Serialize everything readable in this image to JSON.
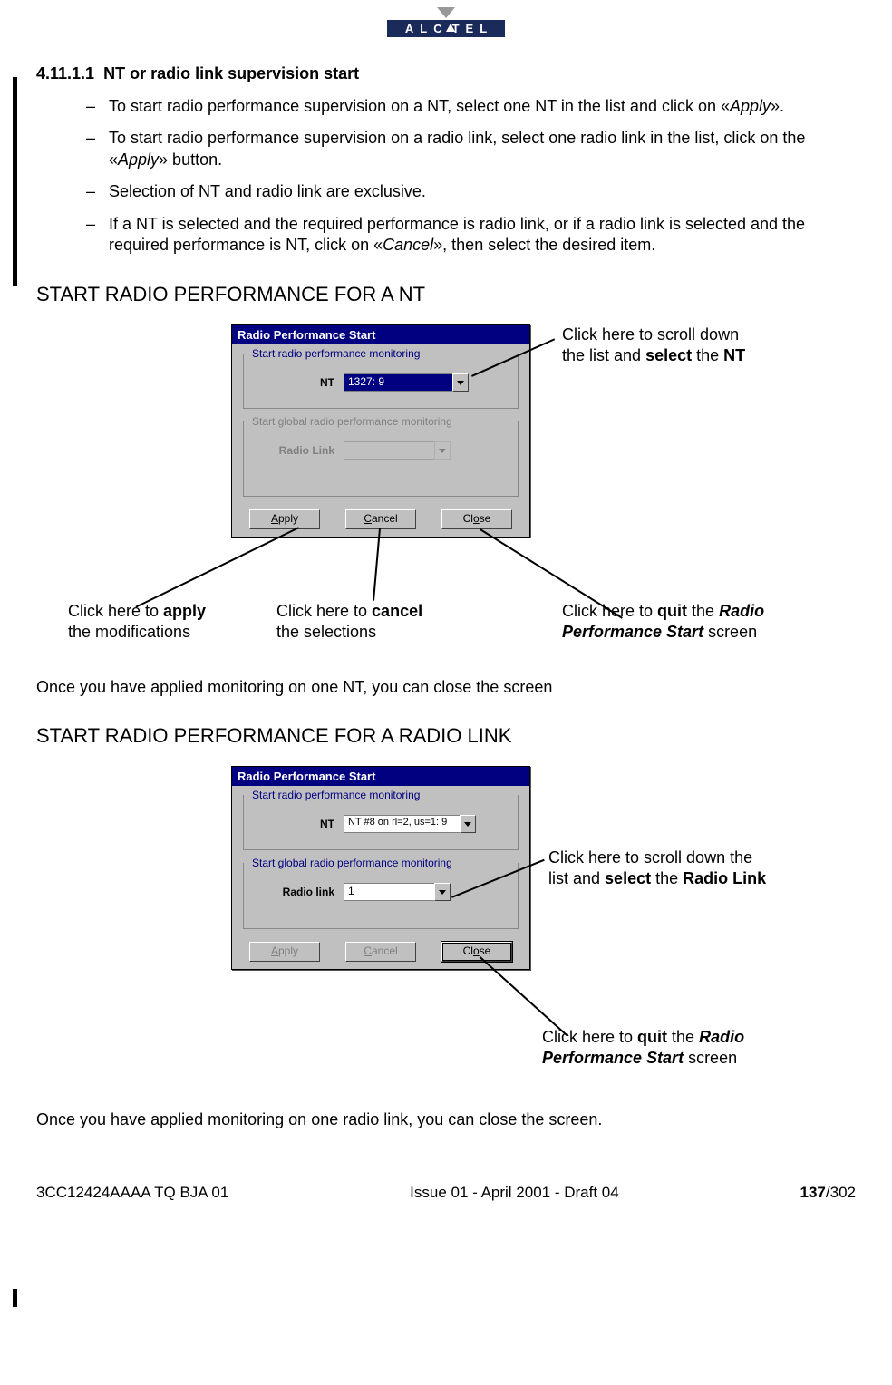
{
  "logo": {
    "text": "ALC TEL"
  },
  "section": {
    "number": "4.11.1.1",
    "title": "NT or radio link supervision start"
  },
  "bullets": {
    "b1a": "To start radio performance supervision on a NT, select one NT in the list and click on «",
    "b1b": "Apply",
    "b1c": "».",
    "b2a": "To start radio performance supervision on a radio link, select one radio link in the list, click on the «",
    "b2b": "Apply",
    "b2c": "» button.",
    "b3": "Selection of NT and radio link are exclusive.",
    "b4a": "If a NT is selected and the required performance is radio link, or if a radio link is selected and the required performance is NT, click on «",
    "b4b": "Cancel",
    "b4c": "», then select the desired item."
  },
  "headingA": "START RADIO PERFORMANCE FOR A NT",
  "dialogA": {
    "title": "Radio Performance Start",
    "group1": "Start radio performance monitoring",
    "ntLabel": "NT",
    "ntValue": "1327: 9",
    "group2": "Start global radio performance monitoring",
    "rlLabel": "Radio Link",
    "rlValue": "",
    "apply": "Apply",
    "cancel": "Cancel",
    "close": "Close"
  },
  "calloutsA": {
    "scroll_a": "Click here to scroll down",
    "scroll_b": "the list and ",
    "scroll_c": "select",
    "scroll_d": " the ",
    "scroll_e": "NT",
    "apply_a": "Click here to ",
    "apply_b": "apply",
    "apply_c": "the modifications",
    "cancel_a": "Click here to ",
    "cancel_b": "cancel",
    "cancel_c": "the selections",
    "quit_a": "Click here to ",
    "quit_b": "quit",
    "quit_c": " the ",
    "quit_d": "Radio Performance Start",
    "quit_e": " screen"
  },
  "afterA": "Once you have applied monitoring on one NT, you can close the screen",
  "headingB": "START RADIO PERFORMANCE FOR A RADIO LINK",
  "dialogB": {
    "title": "Radio Performance Start",
    "group1": "Start radio performance monitoring",
    "ntLabel": "NT",
    "ntValue": "NT #8 on rl=2, us=1: 9",
    "group2": "Start global radio performance monitoring",
    "rlLabel": "Radio link",
    "rlValue": "1",
    "apply": "Apply",
    "cancel": "Cancel",
    "close": "Close"
  },
  "calloutsB": {
    "scroll_a": "Click here to scroll down the",
    "scroll_b": "list and ",
    "scroll_c": "select",
    "scroll_d": " the ",
    "scroll_e": "Radio Link",
    "quit_a": "Click here to ",
    "quit_b": "quit",
    "quit_c": " the ",
    "quit_d": "Radio Performance Start",
    "quit_e": " screen"
  },
  "afterB": "Once you have applied monitoring on one radio link, you can close the screen.",
  "footer": {
    "left": "3CC12424AAAA TQ BJA 01",
    "center": "Issue 01 - April 2001 - Draft 04",
    "page": "137",
    "total": "/302"
  }
}
